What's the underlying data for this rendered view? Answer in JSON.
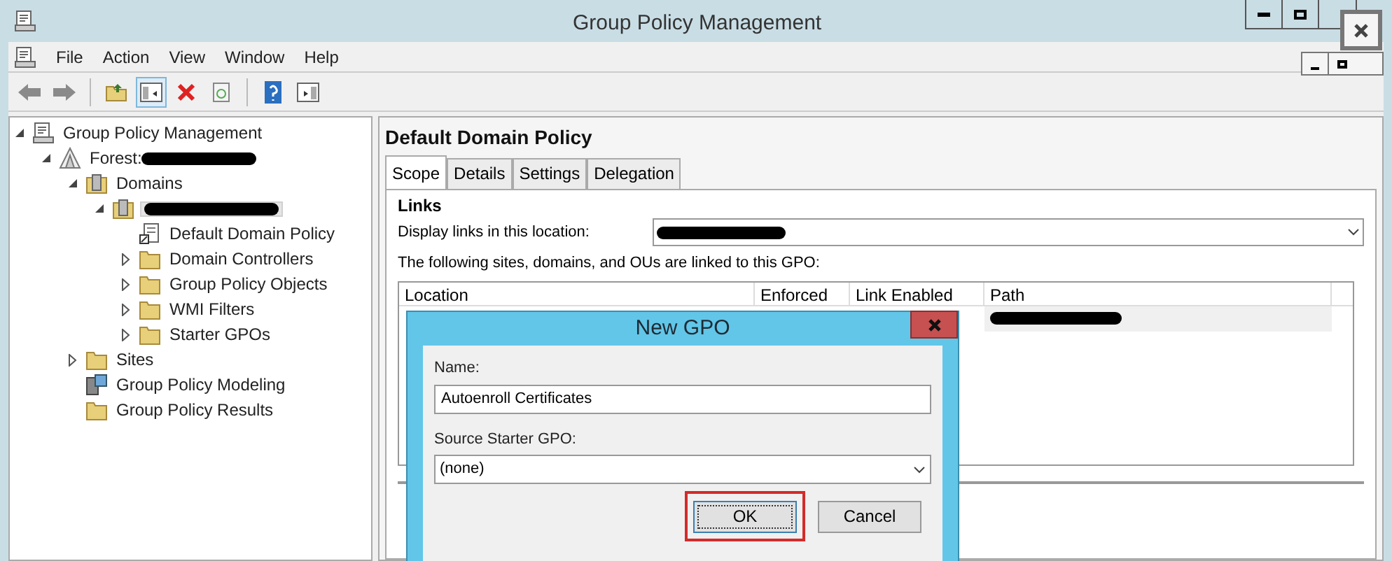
{
  "window": {
    "title": "Group Policy Management"
  },
  "menu": [
    "File",
    "Action",
    "View",
    "Window",
    "Help"
  ],
  "tree": [
    {
      "label": "Group Policy Management",
      "kind": "console",
      "expanded": true,
      "children": [
        {
          "label": "Forest:",
          "kind": "forest",
          "redacted": true,
          "expanded": true,
          "children": [
            {
              "label": "Domains",
              "kind": "domains",
              "expanded": true,
              "children": [
                {
                  "kind": "domains",
                  "redacted": true,
                  "selected": true,
                  "expanded": true,
                  "children": [
                    {
                      "label": "Default Domain Policy",
                      "kind": "link"
                    },
                    {
                      "label": "Domain Controllers",
                      "kind": "folder",
                      "expanded": false
                    },
                    {
                      "label": "Group Policy Objects",
                      "kind": "folder",
                      "expanded": false
                    },
                    {
                      "label": "WMI Filters",
                      "kind": "folder",
                      "expanded": false
                    },
                    {
                      "label": "Starter GPOs",
                      "kind": "folder",
                      "expanded": false
                    }
                  ]
                }
              ]
            },
            {
              "label": "Sites",
              "kind": "folder",
              "expanded": false
            },
            {
              "label": "Group Policy Modeling",
              "kind": "modeling"
            },
            {
              "label": "Group Policy Results",
              "kind": "folder"
            }
          ]
        }
      ]
    }
  ],
  "details": {
    "title": "Default Domain Policy",
    "tabs": [
      {
        "label": "Scope",
        "selected": true
      },
      {
        "label": "Details",
        "selected": false
      },
      {
        "label": "Settings",
        "selected": false
      },
      {
        "label": "Delegation",
        "selected": false
      }
    ],
    "section": "Links",
    "location_label": "Display links in this location:",
    "linked_text": "The following sites, domains, and OUs are linked to this GPO:",
    "columns": [
      "Location",
      "Enforced",
      "Link Enabled",
      "Path"
    ]
  },
  "dialog": {
    "title": "New GPO",
    "name_label": "Name:",
    "name_value": "Autoenroll Certificates",
    "source_label": "Source Starter GPO:",
    "source_value": "(none)",
    "buttons": [
      {
        "label": "OK",
        "highlighted": true
      },
      {
        "label": "Cancel",
        "highlighted": false
      }
    ]
  }
}
